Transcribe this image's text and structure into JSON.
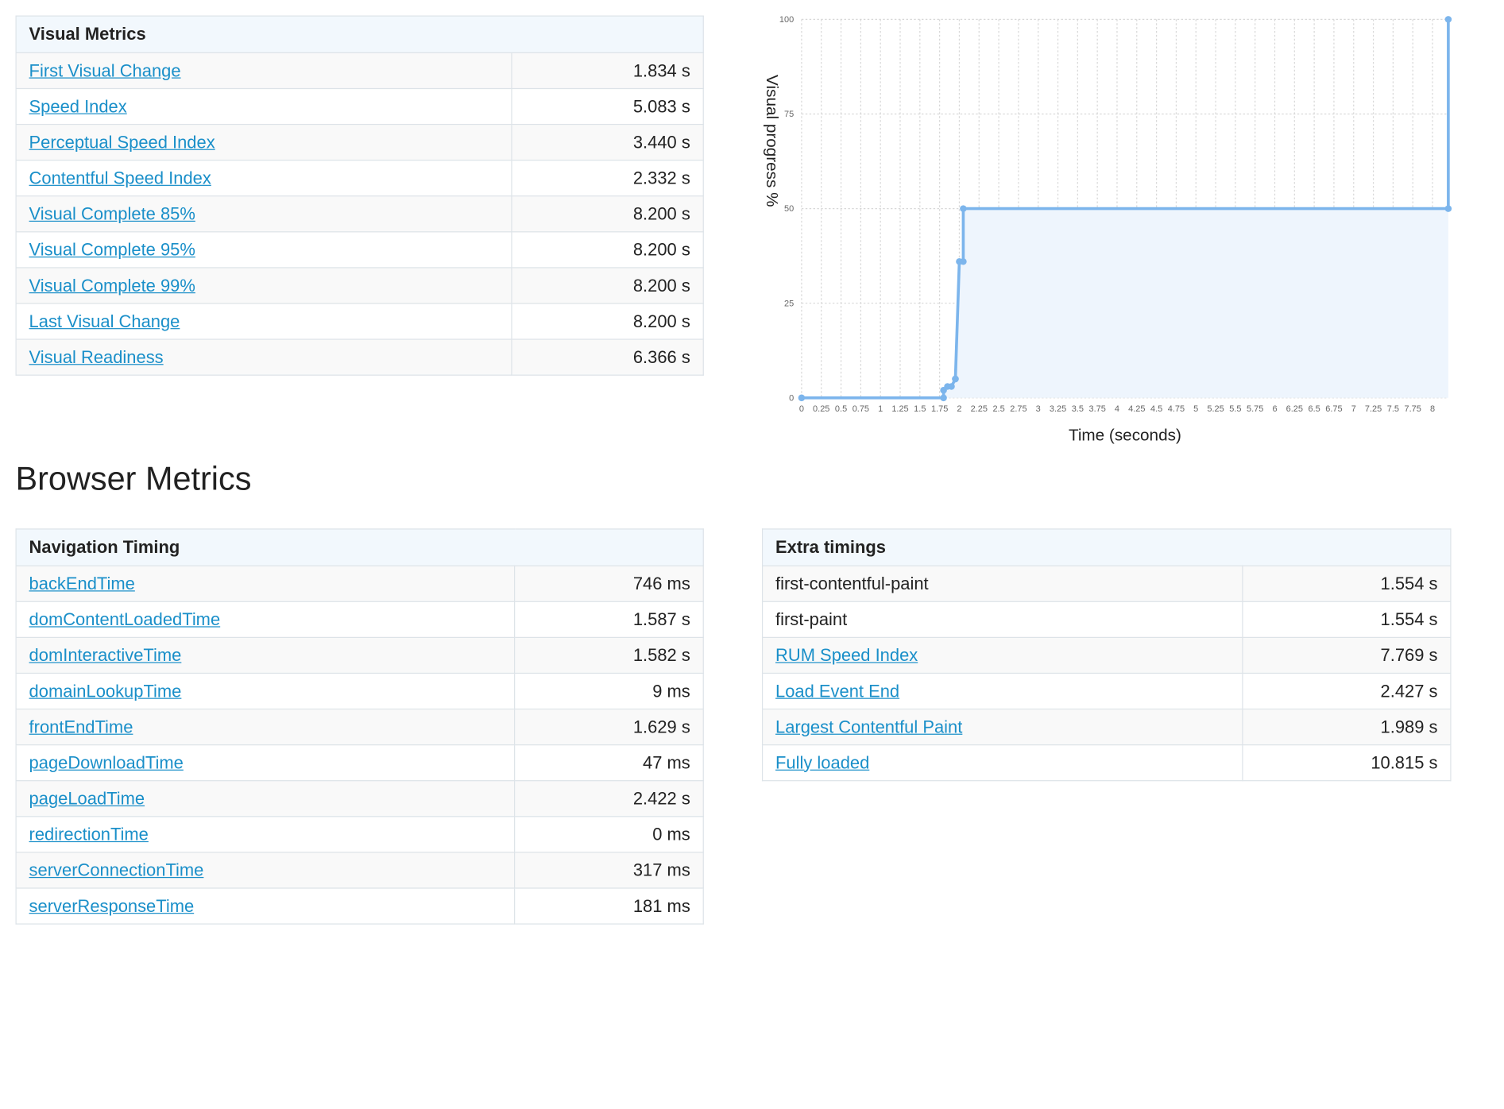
{
  "visual_metrics": {
    "header": "Visual Metrics",
    "rows": [
      {
        "label": "First Visual Change",
        "value": "1.834 s",
        "link": true
      },
      {
        "label": "Speed Index",
        "value": "5.083 s",
        "link": true
      },
      {
        "label": "Perceptual Speed Index",
        "value": "3.440 s",
        "link": true
      },
      {
        "label": "Contentful Speed Index",
        "value": "2.332 s",
        "link": true
      },
      {
        "label": "Visual Complete 85%",
        "value": "8.200 s",
        "link": true
      },
      {
        "label": "Visual Complete 95%",
        "value": "8.200 s",
        "link": true
      },
      {
        "label": "Visual Complete 99%",
        "value": "8.200 s",
        "link": true
      },
      {
        "label": "Last Visual Change",
        "value": "8.200 s",
        "link": true
      },
      {
        "label": "Visual Readiness",
        "value": "6.366 s",
        "link": true
      }
    ]
  },
  "browser_metrics_title": "Browser Metrics",
  "navigation_timing": {
    "header": "Navigation Timing",
    "rows": [
      {
        "label": "backEndTime",
        "value": "746 ms",
        "link": true
      },
      {
        "label": "domContentLoadedTime",
        "value": "1.587 s",
        "link": true
      },
      {
        "label": "domInteractiveTime",
        "value": "1.582 s",
        "link": true
      },
      {
        "label": "domainLookupTime",
        "value": "9 ms",
        "link": true
      },
      {
        "label": "frontEndTime",
        "value": "1.629 s",
        "link": true
      },
      {
        "label": "pageDownloadTime",
        "value": "47 ms",
        "link": true
      },
      {
        "label": "pageLoadTime",
        "value": "2.422 s",
        "link": true
      },
      {
        "label": "redirectionTime",
        "value": "0 ms",
        "link": true
      },
      {
        "label": "serverConnectionTime",
        "value": "317 ms",
        "link": true
      },
      {
        "label": "serverResponseTime",
        "value": "181 ms",
        "link": true
      }
    ]
  },
  "extra_timings": {
    "header": "Extra timings",
    "rows": [
      {
        "label": "first-contentful-paint",
        "value": "1.554 s",
        "link": false
      },
      {
        "label": "first-paint",
        "value": "1.554 s",
        "link": false
      },
      {
        "label": "RUM Speed Index",
        "value": "7.769 s",
        "link": true
      },
      {
        "label": "Load Event End",
        "value": "2.427 s",
        "link": true
      },
      {
        "label": "Largest Contentful Paint",
        "value": "1.989 s",
        "link": true
      },
      {
        "label": "Fully loaded",
        "value": "10.815 s",
        "link": true
      }
    ]
  },
  "chart_data": {
    "type": "line",
    "xlabel": "Time (seconds)",
    "ylabel": "Visual progress %",
    "xlim": [
      0,
      8.2
    ],
    "ylim": [
      0,
      100
    ],
    "yticks": [
      0,
      25,
      50,
      75,
      100
    ],
    "xtick_labels": [
      "0",
      "0.25",
      "0.5",
      "0.75",
      "1",
      "1.25",
      "1.5",
      "1.75",
      "2",
      "2.25",
      "2.5",
      "2.75",
      "3",
      "3.25",
      "3.5",
      "3.75",
      "4",
      "4.25",
      "4.5",
      "4.75",
      "5",
      "5.25",
      "5.5",
      "5.75",
      "6",
      "6.25",
      "6.5",
      "6.75",
      "7",
      "7.25",
      "7.5",
      "7.75",
      "8"
    ],
    "grid": true,
    "step": true,
    "colors": {
      "line": "#7cb5ec",
      "fill": "#eef5fd",
      "grid": "#d8d8d8"
    },
    "series": [
      {
        "x": [
          0,
          1.8,
          1.8,
          1.85,
          1.9,
          1.95,
          1.95,
          2.0,
          2.05,
          2.05,
          8.2,
          8.2
        ],
        "y": [
          0,
          0,
          2,
          3,
          3,
          5,
          5,
          36,
          36,
          50,
          50,
          100
        ]
      }
    ]
  }
}
